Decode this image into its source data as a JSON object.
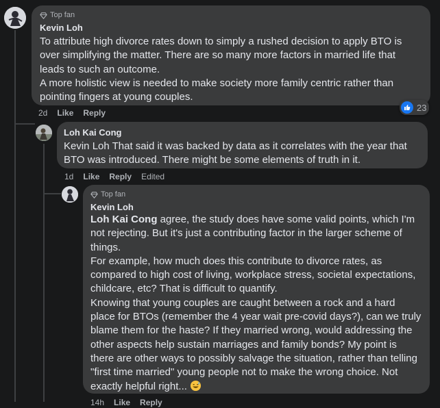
{
  "comments": [
    {
      "badge": "Top fan",
      "author": "Kevin Loh",
      "paragraphs": [
        "To attribute high divorce rates down to simply a rushed decision to apply BTO is over simplifying the matter. There are so many more factors in married life that leads to such an outcome.",
        "A more holistic view is needed to make society more family centric rather than pointing fingers at young couples."
      ],
      "time": "2d",
      "like_label": "Like",
      "reply_label": "Reply",
      "reaction_count": "23",
      "reaction_icon": "like-icon",
      "colors": {
        "bubble": "#3a3b3c",
        "like_blue": "#1877f2"
      }
    },
    {
      "author": "Loh Kai Cong",
      "paragraphs": [
        "Kevin Loh That said it was backed by data as it correlates with the year that BTO was introduced. There might be some elements of truth in it."
      ],
      "time": "1d",
      "like_label": "Like",
      "reply_label": "Reply",
      "edited_label": "Edited"
    },
    {
      "badge": "Top fan",
      "author": "Kevin Loh",
      "mention": "Loh Kai Cong",
      "first_text": " agree, the study does have some valid points, which I'm not rejecting. But it's just a contributing factor in the larger scheme of things.",
      "paragraphs": [
        "For example, how much does this contribute to divorce rates, as compared to high cost of living, workplace stress, societal expectations, childcare, etc? That is difficult to quantify.",
        "Knowing that young couples are caught between a rock and a hard place for BTOs (remember the 4 year wait pre-covid days?), can we truly blame them for the haste? If they married wrong, would addressing the other aspects help sustain marriages and family bonds? My point is there are other ways to possibly salvage the situation, rather than telling \"first time married\" young people not to make the wrong choice. Not exactly helpful right..."
      ],
      "emoji": "sweat-smile-emoji",
      "time": "14h",
      "like_label": "Like",
      "reply_label": "Reply"
    }
  ]
}
